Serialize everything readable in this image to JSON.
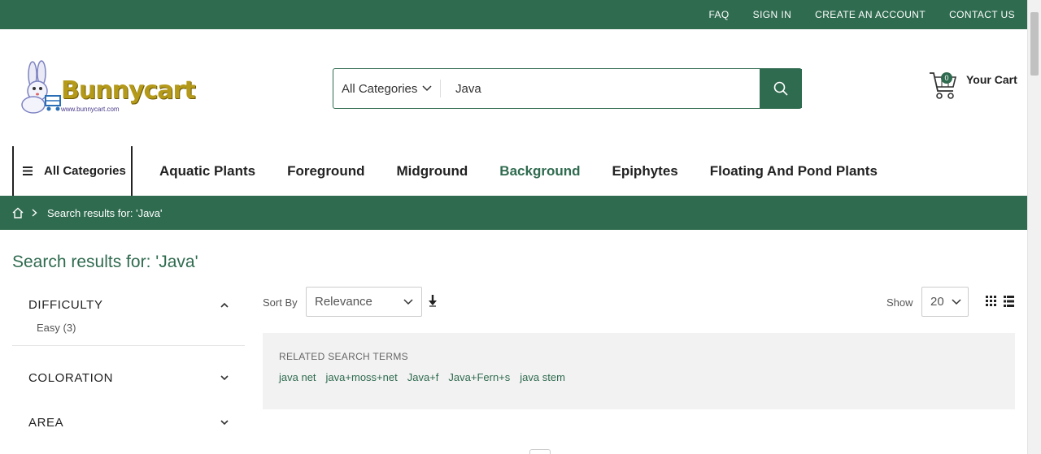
{
  "topbar": {
    "links": [
      "FAQ",
      "SIGN IN",
      "CREATE AN ACCOUNT",
      "CONTACT US"
    ]
  },
  "logo": {
    "text": "Bunnycart",
    "url_text": "www.bunnycart.com"
  },
  "search": {
    "category": "All Categories",
    "value": "Java",
    "icon": "search-icon"
  },
  "cart": {
    "count": "0",
    "label": "Your Cart"
  },
  "nav": {
    "all_categories": "All Categories",
    "items": [
      "Aquatic Plants",
      "Foreground",
      "Midground",
      "Background",
      "Epiphytes",
      "Floating And Pond Plants"
    ],
    "active": "Background"
  },
  "breadcrumb": {
    "current": "Search results for: 'Java'"
  },
  "page": {
    "title": "Search results for: 'Java'"
  },
  "filters": [
    {
      "title": "DIFFICULTY",
      "expanded": true,
      "options": [
        "Easy (3)"
      ]
    },
    {
      "title": "COLORATION",
      "expanded": false
    },
    {
      "title": "AREA",
      "expanded": false
    }
  ],
  "toolbar": {
    "sort_label": "Sort By",
    "sort_value": "Relevance",
    "show_label": "Show",
    "show_value": "20"
  },
  "related": {
    "title": "RELATED SEARCH TERMS",
    "terms": [
      "java net",
      "java+moss+net",
      "Java+f",
      "Java+Fern+s",
      "java stem"
    ]
  },
  "colors": {
    "brand": "#2f6b4f"
  }
}
